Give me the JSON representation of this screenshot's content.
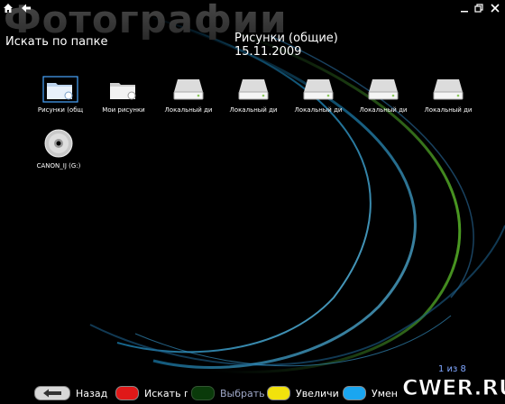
{
  "window": {
    "title": "Фотографии",
    "controls": [
      "home-icon",
      "back-arrow-icon",
      "minimize-icon",
      "restore-icon",
      "close-icon"
    ]
  },
  "header": {
    "search_folder_label": "Искать по папке",
    "current_item_name": "Рисунки (общие)",
    "current_item_date": "15.11.2009"
  },
  "items": [
    {
      "label": "Рисунки (общ",
      "icon": "pictures-folder-icon",
      "selected": true
    },
    {
      "label": "Мои рисунки",
      "icon": "pictures-folder-icon",
      "selected": false
    },
    {
      "label": "Локальный ди",
      "icon": "hard-drive-icon",
      "selected": false
    },
    {
      "label": "Локальный ди",
      "icon": "hard-drive-icon",
      "selected": false
    },
    {
      "label": "Локальный ди",
      "icon": "hard-drive-icon",
      "selected": false
    },
    {
      "label": "Локальный ди",
      "icon": "hard-drive-icon",
      "selected": false
    },
    {
      "label": "Локальный ди",
      "icon": "hard-drive-icon",
      "selected": false
    },
    {
      "label": "CANON_IJ (G:)",
      "icon": "cd-disc-icon",
      "selected": false
    }
  ],
  "pagination": {
    "text": "1 из 8"
  },
  "bottom_bar": {
    "back_label": "Назад",
    "red_label": "Искать п",
    "green_label": "Выбрать",
    "yellow_label": "Увеличи",
    "blue_label": "Умен",
    "colors": {
      "red": "#e01818",
      "green": "#0a3a0a",
      "yellow": "#f2e20c",
      "blue": "#1aa6f0"
    }
  },
  "watermark": {
    "text": "CWER.RU"
  }
}
